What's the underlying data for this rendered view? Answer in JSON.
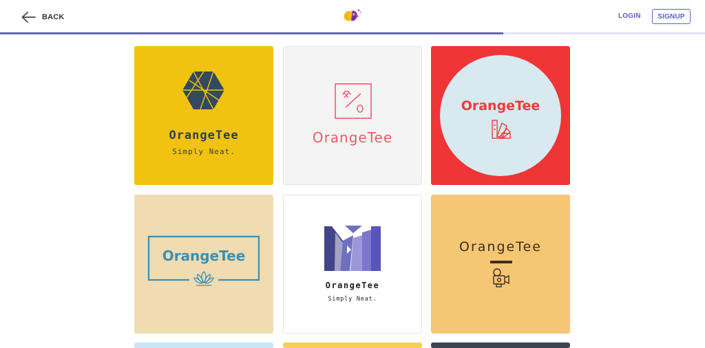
{
  "header": {
    "back_label": "BACK",
    "login_label": "LOGIN",
    "signup_label": "SIGNUP",
    "progress_fraction": 0.714
  },
  "colors": {
    "accent": "#5a5fc2",
    "progress_track": "#e3e4f4"
  },
  "logos": [
    {
      "name": "OrangeTee",
      "tagline": "Simply Neat.",
      "background": "#f1c30f",
      "icon": "hexagon-icon"
    },
    {
      "name": "OrangeTee",
      "background": "#f4f4f4",
      "icon": "percent-box-icon"
    },
    {
      "name": "OrangeTee",
      "background": "#ef3535",
      "icon": "color-swatch-icon"
    },
    {
      "name": "OrangeTee",
      "background": "#f0dcb1",
      "icon": "lotus-icon"
    },
    {
      "name": "OrangeTee",
      "tagline": "Simply Neat.",
      "background": "#ffffff",
      "icon": "bars-m-icon"
    },
    {
      "name": "OrangeTee",
      "background": "#f5c674",
      "icon": "camera-icon"
    },
    {
      "background": "#c8e6f6"
    },
    {
      "background": "#f7cf52"
    },
    {
      "background": "#3c4452"
    }
  ]
}
